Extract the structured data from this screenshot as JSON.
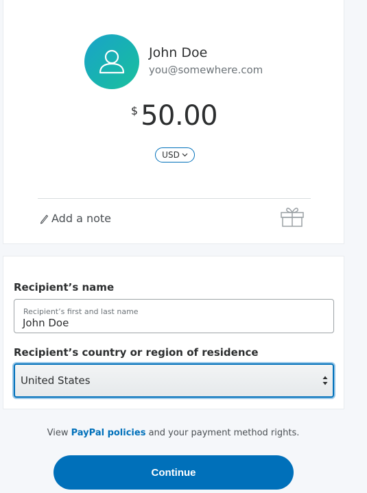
{
  "recipient": {
    "name": "John Doe",
    "email": "you@somewhere.com",
    "avatar_icon": "user-outline-icon"
  },
  "payment": {
    "currency_symbol": "$",
    "amount": "50.00",
    "currency_code": "USD"
  },
  "note": {
    "label": "Add a note",
    "icon": "pencil-icon"
  },
  "gift": {
    "icon": "gift-icon"
  },
  "form": {
    "name_label": "Recipient’s name",
    "name_placeholder": "Recipient’s first and last name",
    "name_value": "John Doe",
    "country_label": "Recipient’s country or region of residence",
    "country_value": "United States"
  },
  "footer": {
    "policy_prefix": "View ",
    "policy_link": "PayPal policies",
    "policy_suffix": " and your payment method rights.",
    "continue_label": "Continue"
  },
  "colors": {
    "brand_blue": "#0070ba",
    "avatar_gradient_start": "#1aa3c9",
    "avatar_gradient_end": "#1bc09e"
  }
}
